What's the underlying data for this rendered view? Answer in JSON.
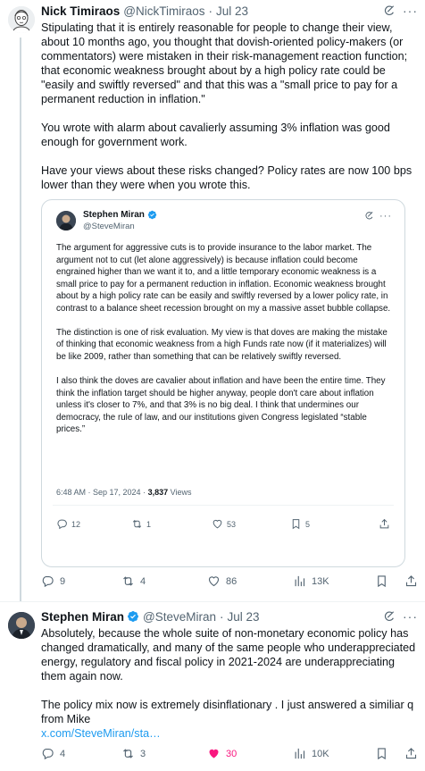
{
  "tweet1": {
    "author_name": "Nick Timiraos",
    "handle": "@NickTimiraos",
    "separator": "·",
    "date": "Jul 23",
    "paragraphs": [
      "Stipulating that it is entirely reasonable for people to change their view, about 10 months ago, you thought that dovish-oriented policy-makers (or commentators) were mistaken in their risk-management reaction function; that economic weakness brought about by a high policy rate could be \"easily and swiftly reversed\" and that this was a \"small price to pay for a permanent reduction in inflation.\"",
      "You wrote with alarm about cavalierly assuming 3% inflation was good enough for government work.",
      "Have your views about these risks changed? Policy rates are now 100 bps lower than they were when you wrote this."
    ],
    "quote": {
      "author_name": "Stephen Miran",
      "handle": "@SteveMiran",
      "paragraphs": [
        "The argument for aggressive cuts is to provide insurance to the labor market. The argument not to cut (let alone aggressively) is because inflation could become engrained higher than we want it to, and a little temporary economic weakness is a small price to pay for a permanent reduction in inflation. Economic weakness brought about by a high policy rate can be easily and swiftly reversed by a lower policy rate, in contrast to a balance sheet recession brought on my a massive asset bubble collapse.",
        "The distinction is one of risk evaluation. My view is that doves are making the mistake of thinking that economic weakness from a high Funds rate now (if it materializes) will be like 2009, rather than something that can be relatively swiftly reversed.",
        "I also think the doves are cavalier about inflation and have been the entire time. They think the inflation target should be higher anyway, people don't care about inflation unless it's closer to 7%, and that 3% is no big deal. I think that undermines our democracy, the rule of law, and our institutions given Congress legislated “stable prices.”"
      ],
      "timestamp": "6:48 AM · Sep 17, 2024 · ",
      "views_count": "3,837",
      "views_label": " Views",
      "replies": "12",
      "reposts": "1",
      "likes": "53",
      "bookmarks": "5"
    },
    "replies": "9",
    "reposts": "4",
    "likes": "86",
    "views": "13K"
  },
  "tweet2": {
    "author_name": "Stephen Miran",
    "handle": "@SteveMiran",
    "separator": "·",
    "date": "Jul 23",
    "paragraphs": [
      "Absolutely, because the whole suite of non-monetary economic policy has changed dramatically, and many of the same people who underappreciated energy, regulatory and fiscal policy in 2021-2024 are underappreciating them again now.",
      "The policy mix now is extremely disinflationary .  I just answered a similiar q from Mike"
    ],
    "link": "x.com/SteveMiran/sta…",
    "replies": "4",
    "reposts": "3",
    "likes": "30",
    "views": "10K",
    "liked": true
  },
  "colors": {
    "text": "#0f1419",
    "secondary": "#536471",
    "link": "#1d9bf0",
    "verified": "#1d9bf0",
    "like_active": "#f91880",
    "border": "#cfd9de"
  },
  "icons": [
    "verified-badge-icon",
    "grok-icon",
    "more-icon",
    "reply-icon",
    "repost-icon",
    "like-icon",
    "views-icon",
    "bookmark-icon",
    "share-icon"
  ]
}
